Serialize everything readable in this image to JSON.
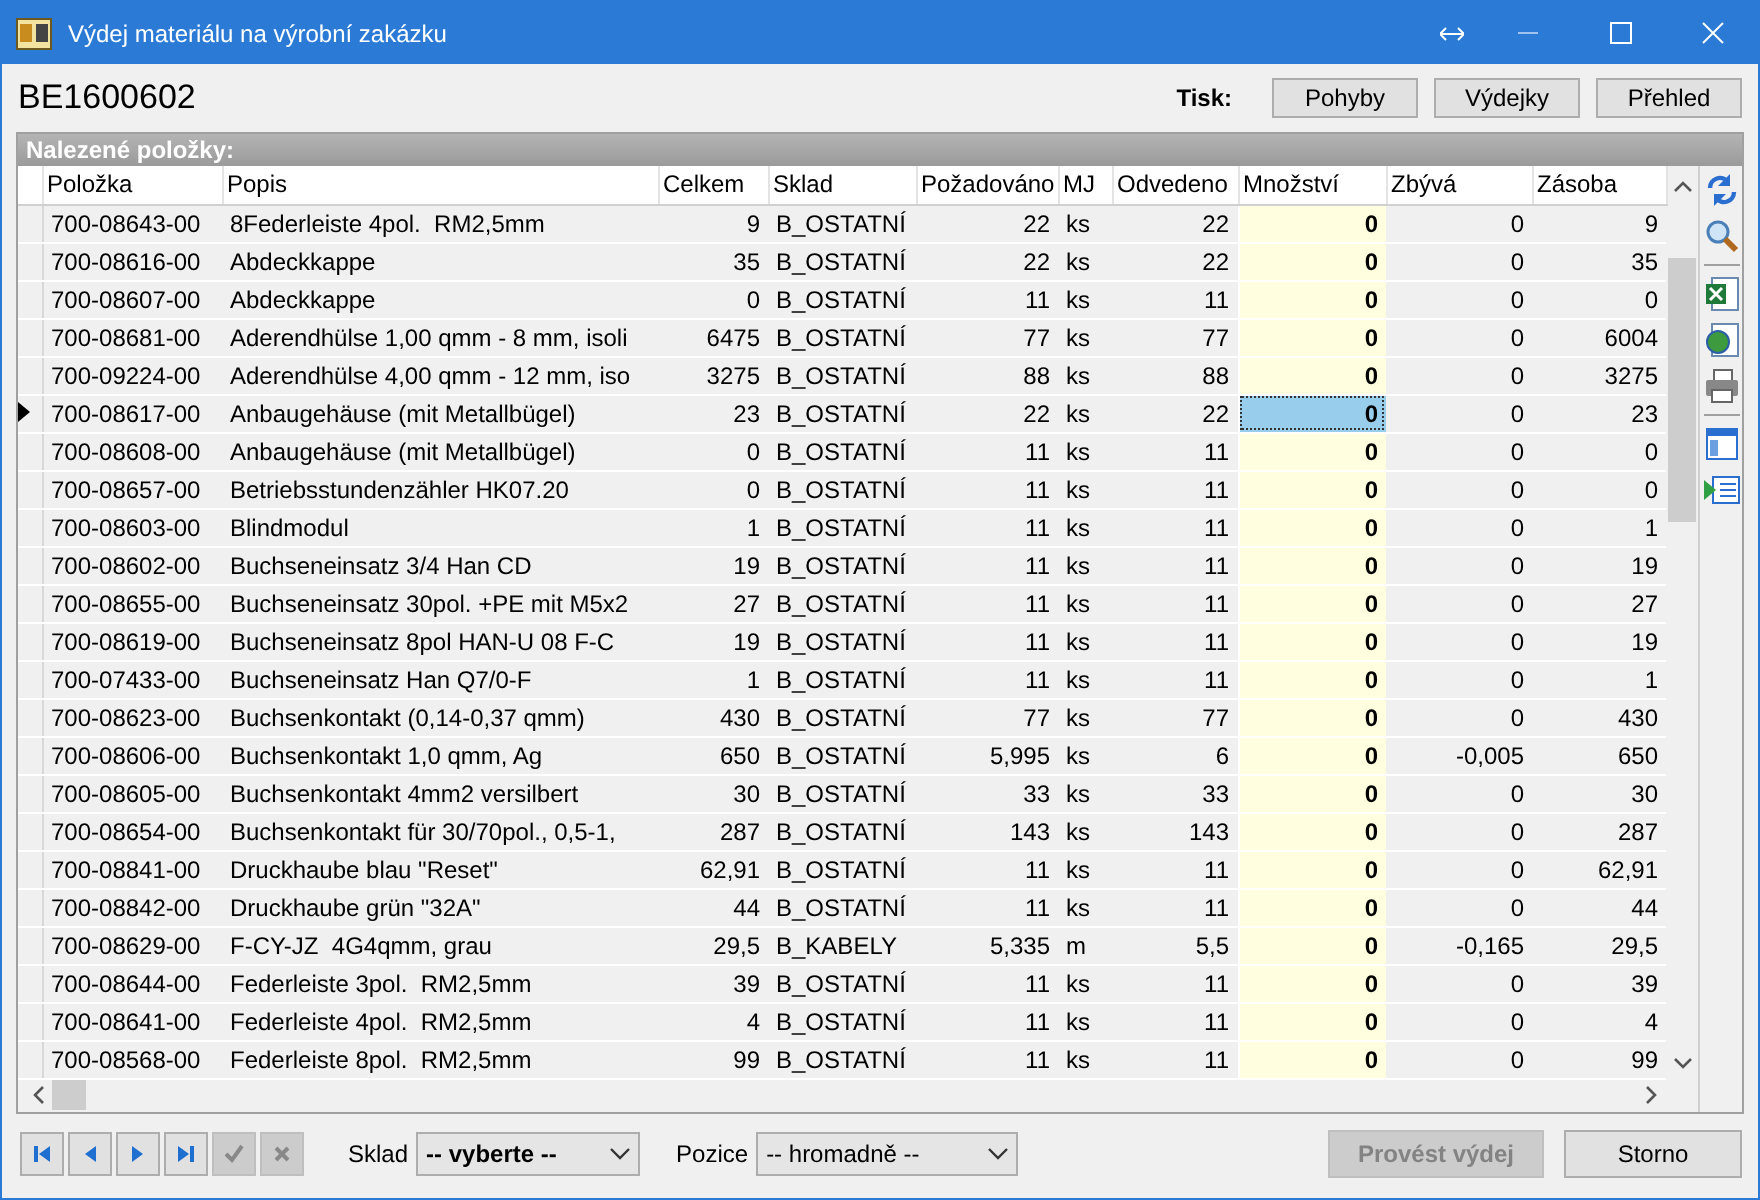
{
  "window": {
    "title": "Výdej materiálu na výrobní zakázku"
  },
  "header": {
    "document": "BE1600602",
    "print_label": "Tisk:",
    "print_buttons": [
      "Pohyby",
      "Výdejky",
      "Přehled"
    ]
  },
  "grid": {
    "caption": "Nalezené položky:",
    "columns": [
      "Položka",
      "Popis",
      "Celkem",
      "Sklad",
      "Požadováno",
      "MJ",
      "Odvedeno",
      "Množství",
      "Zbývá",
      "Zásoba"
    ],
    "rows": [
      {
        "current": false,
        "cells": [
          "700-08643-00",
          "8Federleiste 4pol.  RM2,5mm",
          "9",
          "B_OSTATNÍ",
          "22",
          "ks",
          "22",
          "0",
          "0",
          "9"
        ]
      },
      {
        "current": false,
        "cells": [
          "700-08616-00",
          "Abdeckkappe",
          "35",
          "B_OSTATNÍ",
          "22",
          "ks",
          "22",
          "0",
          "0",
          "35"
        ]
      },
      {
        "current": false,
        "cells": [
          "700-08607-00",
          "Abdeckkappe",
          "0",
          "B_OSTATNÍ",
          "11",
          "ks",
          "11",
          "0",
          "0",
          "0"
        ]
      },
      {
        "current": false,
        "cells": [
          "700-08681-00",
          "Aderendhülse 1,00 qmm - 8 mm, isoli",
          "6475",
          "B_OSTATNÍ",
          "77",
          "ks",
          "77",
          "0",
          "0",
          "6004"
        ]
      },
      {
        "current": false,
        "cells": [
          "700-09224-00",
          "Aderendhülse 4,00 qmm - 12 mm, iso",
          "3275",
          "B_OSTATNÍ",
          "88",
          "ks",
          "88",
          "0",
          "0",
          "3275"
        ]
      },
      {
        "current": true,
        "cells": [
          "700-08617-00",
          "Anbaugehäuse (mit Metallbügel)",
          "23",
          "B_OSTATNÍ",
          "22",
          "ks",
          "22",
          "0",
          "0",
          "23"
        ]
      },
      {
        "current": false,
        "cells": [
          "700-08608-00",
          "Anbaugehäuse (mit Metallbügel)",
          "0",
          "B_OSTATNÍ",
          "11",
          "ks",
          "11",
          "0",
          "0",
          "0"
        ]
      },
      {
        "current": false,
        "cells": [
          "700-08657-00",
          "Betriebsstundenzähler HK07.20",
          "0",
          "B_OSTATNÍ",
          "11",
          "ks",
          "11",
          "0",
          "0",
          "0"
        ]
      },
      {
        "current": false,
        "cells": [
          "700-08603-00",
          "Blindmodul",
          "1",
          "B_OSTATNÍ",
          "11",
          "ks",
          "11",
          "0",
          "0",
          "1"
        ]
      },
      {
        "current": false,
        "cells": [
          "700-08602-00",
          "Buchseneinsatz 3/4 Han CD",
          "19",
          "B_OSTATNÍ",
          "11",
          "ks",
          "11",
          "0",
          "0",
          "19"
        ]
      },
      {
        "current": false,
        "cells": [
          "700-08655-00",
          "Buchseneinsatz 30pol. +PE mit M5x2",
          "27",
          "B_OSTATNÍ",
          "11",
          "ks",
          "11",
          "0",
          "0",
          "27"
        ]
      },
      {
        "current": false,
        "cells": [
          "700-08619-00",
          "Buchseneinsatz 8pol HAN-U 08 F-C",
          "19",
          "B_OSTATNÍ",
          "11",
          "ks",
          "11",
          "0",
          "0",
          "19"
        ]
      },
      {
        "current": false,
        "cells": [
          "700-07433-00",
          "Buchseneinsatz Han Q7/0-F",
          "1",
          "B_OSTATNÍ",
          "11",
          "ks",
          "11",
          "0",
          "0",
          "1"
        ]
      },
      {
        "current": false,
        "cells": [
          "700-08623-00",
          "Buchsenkontakt (0,14-0,37 qmm)",
          "430",
          "B_OSTATNÍ",
          "77",
          "ks",
          "77",
          "0",
          "0",
          "430"
        ]
      },
      {
        "current": false,
        "cells": [
          "700-08606-00",
          "Buchsenkontakt 1,0 qmm, Ag",
          "650",
          "B_OSTATNÍ",
          "5,995",
          "ks",
          "6",
          "0",
          "-0,005",
          "650"
        ]
      },
      {
        "current": false,
        "cells": [
          "700-08605-00",
          "Buchsenkontakt 4mm2 versilbert",
          "30",
          "B_OSTATNÍ",
          "33",
          "ks",
          "33",
          "0",
          "0",
          "30"
        ]
      },
      {
        "current": false,
        "cells": [
          "700-08654-00",
          "Buchsenkontakt für 30/70pol., 0,5-1,",
          "287",
          "B_OSTATNÍ",
          "143",
          "ks",
          "143",
          "0",
          "0",
          "287"
        ]
      },
      {
        "current": false,
        "cells": [
          "700-08841-00",
          "Druckhaube blau \"Reset\"",
          "62,91",
          "B_OSTATNÍ",
          "11",
          "ks",
          "11",
          "0",
          "0",
          "62,91"
        ]
      },
      {
        "current": false,
        "cells": [
          "700-08842-00",
          "Druckhaube grün \"32A\"",
          "44",
          "B_OSTATNÍ",
          "11",
          "ks",
          "11",
          "0",
          "0",
          "44"
        ]
      },
      {
        "current": false,
        "cells": [
          "700-08629-00",
          "F-CY-JZ  4G4qmm, grau",
          "29,5",
          "B_KABELY",
          "5,335",
          "m",
          "5,5",
          "0",
          "-0,165",
          "29,5"
        ]
      },
      {
        "current": false,
        "cells": [
          "700-08644-00",
          "Federleiste 3pol.  RM2,5mm",
          "39",
          "B_OSTATNÍ",
          "11",
          "ks",
          "11",
          "0",
          "0",
          "39"
        ]
      },
      {
        "current": false,
        "cells": [
          "700-08641-00",
          "Federleiste 4pol.  RM2,5mm",
          "4",
          "B_OSTATNÍ",
          "11",
          "ks",
          "11",
          "0",
          "0",
          "4"
        ]
      },
      {
        "current": false,
        "cells": [
          "700-08568-00",
          "Federleiste 8pol.  RM2,5mm",
          "99",
          "B_OSTATNÍ",
          "11",
          "ks",
          "11",
          "0",
          "0",
          "99"
        ]
      }
    ]
  },
  "footer": {
    "nav": [
      {
        "kind": "first",
        "disabled": false
      },
      {
        "kind": "prev",
        "disabled": false
      },
      {
        "kind": "next",
        "disabled": false
      },
      {
        "kind": "last",
        "disabled": false
      },
      {
        "kind": "confirm",
        "disabled": true
      },
      {
        "kind": "cancel",
        "disabled": true
      }
    ],
    "warehouse": {
      "label": "Sklad",
      "value": "-- vyberte --"
    },
    "position": {
      "label": "Pozice",
      "value": "-- hromadně --"
    },
    "buttons": [
      {
        "label": "Provést výdej",
        "disabled": true
      },
      {
        "label": "Storno",
        "disabled": false
      }
    ]
  }
}
